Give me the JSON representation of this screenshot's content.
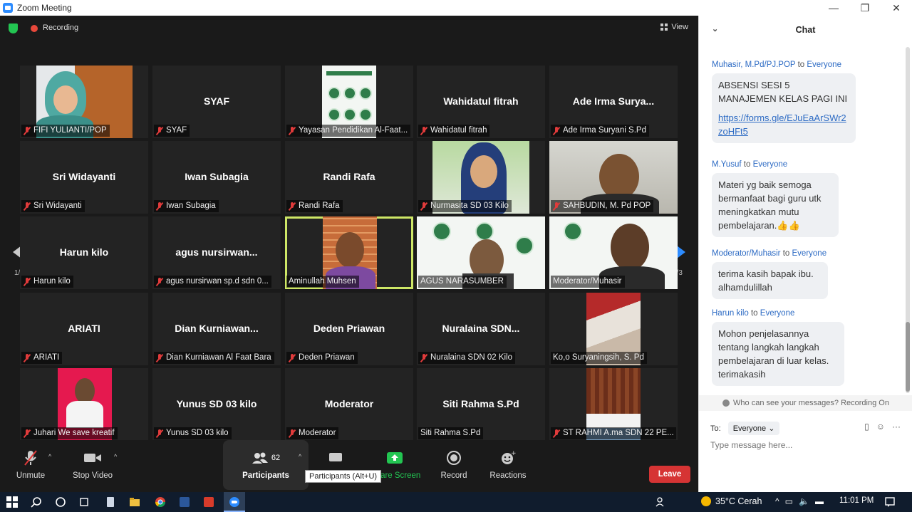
{
  "window": {
    "title": "Zoom Meeting",
    "minimize": "—",
    "restore": "❐",
    "close": "✕"
  },
  "meeting": {
    "recording_label": "Recording",
    "view_label": "View",
    "page_indicator_left": "1/3",
    "page_indicator_right": "1/3",
    "tiles": [
      {
        "name": "",
        "label": "FIFI YULIANTI/POP",
        "muted": true,
        "video": "woman-hijab"
      },
      {
        "name": "SYAF",
        "label": "SYAF",
        "muted": true
      },
      {
        "name": "",
        "label": "Yayasan Pendidikan Al-Faat...",
        "muted": true,
        "video": "slide-small"
      },
      {
        "name": "Wahidatul fitrah",
        "label": "Wahidatul fitrah",
        "muted": true
      },
      {
        "name": "Ade Irma Surya...",
        "label": "Ade Irma Suryani S.Pd",
        "muted": true
      },
      {
        "name": "Sri Widayanti",
        "label": "Sri Widayanti",
        "muted": true
      },
      {
        "name": "Iwan Subagia",
        "label": "Iwan Subagia",
        "muted": true
      },
      {
        "name": "Randi Rafa",
        "label": "Randi Rafa",
        "muted": true
      },
      {
        "name": "",
        "label": "Nurmasita SD 03 Kilo",
        "muted": true,
        "video": "woman-blue"
      },
      {
        "name": "",
        "label": "SAHBUDIN, M. Pd POP",
        "muted": true,
        "video": "man-room"
      },
      {
        "name": "Harun kilo",
        "label": "Harun kilo",
        "muted": true
      },
      {
        "name": "agus nursirwan...",
        "label": "agus nursirwan sp.d sdn 0...",
        "muted": true
      },
      {
        "name": "",
        "label": "Aminullah Muhsen",
        "muted": false,
        "video": "man-brick",
        "active": true
      },
      {
        "name": "",
        "label": "AGUS NARASUMBER",
        "muted": false,
        "video": "slide-man"
      },
      {
        "name": "",
        "label": "Moderator/Muhasir",
        "muted": false,
        "video": "slide-man2"
      },
      {
        "name": "ARIATI",
        "label": "ARIATI",
        "muted": true
      },
      {
        "name": "Dian  Kurniawan...",
        "label": "Dian Kurniawan Al Faat Bara",
        "muted": true
      },
      {
        "name": "Deden Priawan",
        "label": "Deden Priawan",
        "muted": true
      },
      {
        "name": "Nuralaina  SDN...",
        "label": "Nuralaina SDN 02 Kilo",
        "muted": true
      },
      {
        "name": "",
        "label": "Ko,o Suryaningsih, S. Pd",
        "muted": false,
        "video": "ceiling"
      },
      {
        "name": "",
        "label": "Juhari We save kreatif",
        "muted": true,
        "video": "man-red"
      },
      {
        "name": "Yunus SD 03 kilo",
        "label": "Yunus SD 03 kilo",
        "muted": true
      },
      {
        "name": "Moderator",
        "label": "Moderator",
        "muted": true
      },
      {
        "name": "Siti Rahma S.Pd",
        "label": "Siti Rahma S.Pd",
        "muted": false
      },
      {
        "name": "",
        "label": "ST RAHMI  A.ma SDN 22 PE...",
        "muted": true,
        "video": "wood"
      }
    ]
  },
  "toolbar": {
    "unmute": "Unmute",
    "stop_video": "Stop Video",
    "participants": "Participants",
    "participant_count": "62",
    "share_screen": "Share Screen",
    "record": "Record",
    "reactions": "Reactions",
    "leave": "Leave",
    "tooltip": "Participants (Alt+U)"
  },
  "chat": {
    "title": "Chat",
    "messages": [
      {
        "from": "Muhasir, M.Pd/PJ.POP",
        "to": "Everyone",
        "text": "ABSENSI SESI 5 MANAJEMEN KELAS PAGI INI",
        "link": "https://forms.gle/EJuEaArSWr2zoHFt5"
      },
      {
        "from": "M.Yusuf",
        "to": "Everyone",
        "text": "Materi yg baik semoga bermanfaat bagi guru utk meningkatkan mutu pembelajaran.👍👍"
      },
      {
        "from": "Moderator/Muhasir",
        "to": "Everyone",
        "text": "terima kasih bapak ibu. alhamdulillah"
      },
      {
        "from": "Harun kilo",
        "to": "Everyone",
        "text": "Mohon penjelasannya tentang langkah langkah pembelajaran di luar kelas. terimakasih"
      }
    ],
    "to_word": "to",
    "privacy_note": "Who can see your messages? Recording On",
    "to_label": "To:",
    "recipient": "Everyone",
    "input_placeholder": "Type message here..."
  },
  "taskbar": {
    "weather": "35°C  Cerah",
    "clock": "11:01 PM"
  },
  "colors": {
    "accent": "#2d8cff",
    "leave": "#d63434",
    "active_speaker": "#cde666",
    "share": "#23c552"
  }
}
